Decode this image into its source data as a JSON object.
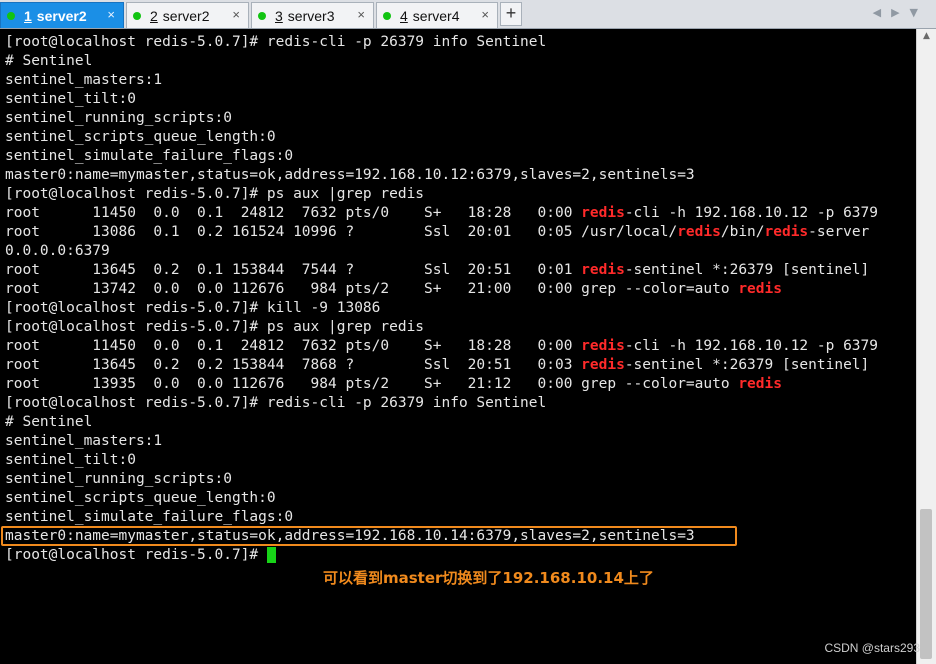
{
  "tabs": [
    {
      "num": "1",
      "label": "server2",
      "active": true
    },
    {
      "num": "2",
      "label": "server2",
      "active": false
    },
    {
      "num": "3",
      "label": "server3",
      "active": false
    },
    {
      "num": "4",
      "label": "server4",
      "active": false
    }
  ],
  "tab_close_glyph": "×",
  "add_tab_glyph": "+",
  "nav_glyphs": "◀▶▼",
  "colors": {
    "active_tab": "#1b8fe6",
    "status_dot": "#12c412",
    "highlight": "#ff2a2a",
    "annotation": "#f08a1d",
    "cursor": "#18d418"
  },
  "terminal": {
    "lines": [
      [
        {
          "t": "[root@localhost redis-5.0.7]# redis-cli -p 26379 info Sentinel"
        }
      ],
      [
        {
          "t": "# Sentinel"
        }
      ],
      [
        {
          "t": "sentinel_masters:1"
        }
      ],
      [
        {
          "t": "sentinel_tilt:0"
        }
      ],
      [
        {
          "t": "sentinel_running_scripts:0"
        }
      ],
      [
        {
          "t": "sentinel_scripts_queue_length:0"
        }
      ],
      [
        {
          "t": "sentinel_simulate_failure_flags:0"
        }
      ],
      [
        {
          "t": "master0:name=mymaster,status=ok,address=192.168.10.12:6379,slaves=2,sentinels=3"
        }
      ],
      [
        {
          "t": "[root@localhost redis-5.0.7]# ps aux |grep redis"
        }
      ],
      [
        {
          "t": "root      11450  0.0  0.1  24812  7632 pts/0    S+   18:28   0:00 "
        },
        {
          "t": "redis",
          "hl": true
        },
        {
          "t": "-cli -h 192.168.10.12 -p 6379"
        }
      ],
      [
        {
          "t": "root      13086  0.1  0.2 161524 10996 ?        Ssl  20:01   0:05 /usr/local/"
        },
        {
          "t": "redis",
          "hl": true
        },
        {
          "t": "/bin/"
        },
        {
          "t": "redis",
          "hl": true
        },
        {
          "t": "-server"
        }
      ],
      [
        {
          "t": "0.0.0.0:6379"
        }
      ],
      [
        {
          "t": "root      13645  0.2  0.1 153844  7544 ?        Ssl  20:51   0:01 "
        },
        {
          "t": "redis",
          "hl": true
        },
        {
          "t": "-sentinel *:26379 [sentinel]"
        }
      ],
      [
        {
          "t": "root      13742  0.0  0.0 112676   984 pts/2    S+   21:00   0:00 grep --color=auto "
        },
        {
          "t": "redis",
          "hl": true
        }
      ],
      [
        {
          "t": "[root@localhost redis-5.0.7]# kill -9 13086"
        }
      ],
      [
        {
          "t": "[root@localhost redis-5.0.7]# ps aux |grep redis"
        }
      ],
      [
        {
          "t": "root      11450  0.0  0.1  24812  7632 pts/0    S+   18:28   0:00 "
        },
        {
          "t": "redis",
          "hl": true
        },
        {
          "t": "-cli -h 192.168.10.12 -p 6379"
        }
      ],
      [
        {
          "t": "root      13645  0.2  0.2 153844  7868 ?        Ssl  20:51   0:03 "
        },
        {
          "t": "redis",
          "hl": true
        },
        {
          "t": "-sentinel *:26379 [sentinel]"
        }
      ],
      [
        {
          "t": "root      13935  0.0  0.0 112676   984 pts/2    S+   21:12   0:00 grep --color=auto "
        },
        {
          "t": "redis",
          "hl": true
        }
      ],
      [
        {
          "t": "[root@localhost redis-5.0.7]# redis-cli -p 26379 info Sentinel"
        }
      ],
      [
        {
          "t": "# Sentinel"
        }
      ],
      [
        {
          "t": "sentinel_masters:1"
        }
      ],
      [
        {
          "t": "sentinel_tilt:0"
        }
      ],
      [
        {
          "t": "sentinel_running_scripts:0"
        }
      ],
      [
        {
          "t": "sentinel_scripts_queue_length:0"
        }
      ],
      [
        {
          "t": "sentinel_simulate_failure_flags:0"
        }
      ],
      [
        {
          "t": "master0:name=mymaster,status=ok,address=192.168.10.14:6379,slaves=2,sentinels=3"
        }
      ],
      [
        {
          "t": "[root@localhost redis-5.0.7]# "
        },
        {
          "t": "",
          "cursor": true
        }
      ]
    ]
  },
  "annotation": {
    "text": "可以看到master切换到了192.168.10.14上了"
  },
  "scroll_up_glyph": "▲",
  "watermark": "CSDN @stars293"
}
